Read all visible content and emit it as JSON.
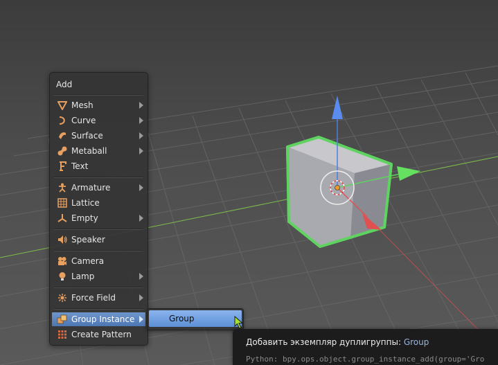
{
  "menu": {
    "title": "Add",
    "items": [
      {
        "label": "Mesh",
        "icon": "mesh-icon",
        "submenu": true
      },
      {
        "label": "Curve",
        "icon": "curve-icon",
        "submenu": true
      },
      {
        "label": "Surface",
        "icon": "surface-icon",
        "submenu": true
      },
      {
        "label": "Metaball",
        "icon": "metaball-icon",
        "submenu": true
      },
      {
        "label": "Text",
        "icon": "text-icon",
        "submenu": false
      },
      {
        "label": "Armature",
        "icon": "armature-icon",
        "submenu": true
      },
      {
        "label": "Lattice",
        "icon": "lattice-icon",
        "submenu": false
      },
      {
        "label": "Empty",
        "icon": "empty-icon",
        "submenu": true
      },
      {
        "label": "Speaker",
        "icon": "speaker-icon",
        "submenu": false
      },
      {
        "label": "Camera",
        "icon": "camera-icon",
        "submenu": false
      },
      {
        "label": "Lamp",
        "icon": "lamp-icon",
        "submenu": true
      },
      {
        "label": "Force Field",
        "icon": "force-field-icon",
        "submenu": true
      },
      {
        "label": "Group Instance",
        "icon": "group-instance-icon",
        "submenu": true,
        "active": true
      },
      {
        "label": "Create Pattern",
        "icon": "create-pattern-icon",
        "submenu": false
      }
    ]
  },
  "submenu": {
    "items": [
      {
        "label": "Group",
        "active": true
      }
    ]
  },
  "tooltip": {
    "description": "Добавить экземпляр дуплигруппы:",
    "value": "Group",
    "python": "Python: bpy.ops.object.group_instance_add(group='Gro"
  },
  "colors": {
    "selection_outline": "#5fd35f",
    "axis_x": "#e05050",
    "axis_y": "#5fd35f",
    "axis_z": "#4a7fe0",
    "menu_highlight": "#5d8fd6"
  }
}
